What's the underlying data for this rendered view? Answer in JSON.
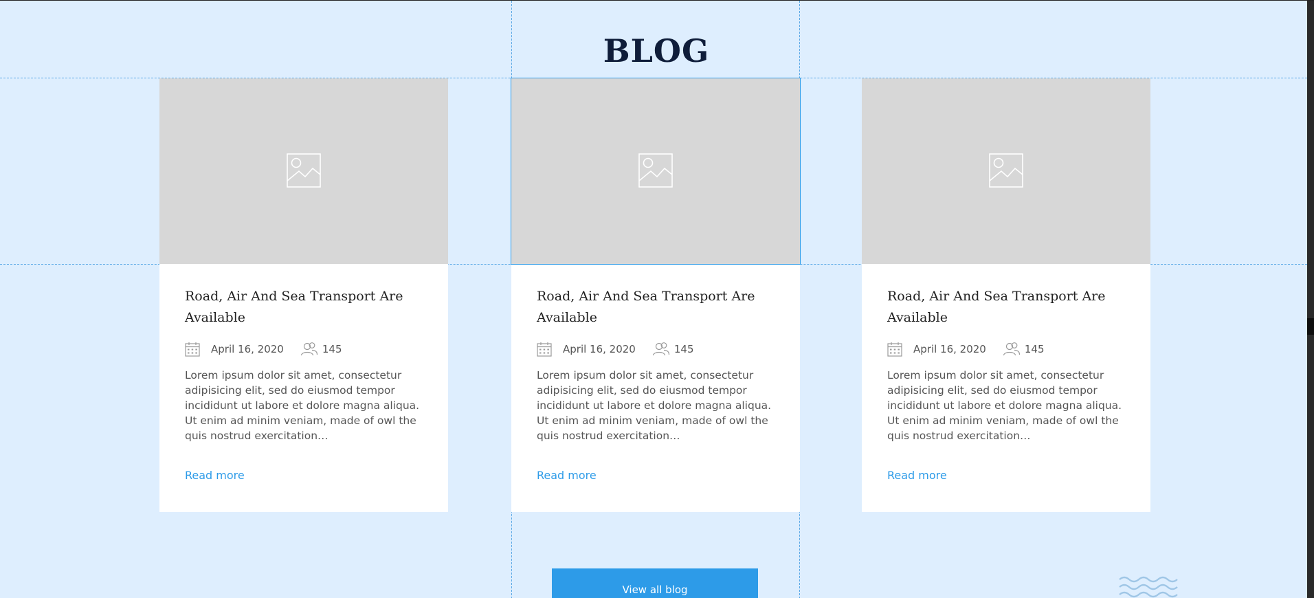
{
  "section": {
    "title": "BLOG"
  },
  "posts": [
    {
      "title": "Road, Air And Sea Transport Are Available",
      "date": "April 16, 2020",
      "views": "145",
      "excerpt": "Lorem ipsum dolor sit amet, consectetur adipisicing elit, sed do eiusmod tempor incididunt ut labore et dolore magna aliqua. Ut enim ad minim veniam, made of owl the quis nostrud exercitation…",
      "read_more": "Read more",
      "image_icon": "image-placeholder-icon"
    },
    {
      "title": "Road, Air And Sea Transport Are Available",
      "date": "April 16, 2020",
      "views": "145",
      "excerpt": "Lorem ipsum dolor sit amet, consectetur adipisicing elit, sed do eiusmod tempor incididunt ut labore et dolore magna aliqua. Ut enim ad minim veniam, made of owl the quis nostrud exercitation…",
      "read_more": "Read more",
      "image_icon": "image-placeholder-icon"
    },
    {
      "title": "Road, Air And Sea Transport Are Available",
      "date": "April 16, 2020",
      "views": "145",
      "excerpt": "Lorem ipsum dolor sit amet, consectetur adipisicing elit, sed do eiusmod tempor incididunt ut labore et dolore magna aliqua. Ut enim ad minim veniam, made of owl the quis nostrud exercitation…",
      "read_more": "Read more",
      "image_icon": "image-placeholder-icon"
    }
  ],
  "view_all_button": {
    "label": "View all blog"
  },
  "icons": {
    "date": "calendar-icon",
    "views": "users-icon",
    "decoration": "waves-icon"
  },
  "colors": {
    "background": "#deeefe",
    "accent": "#2d9be8",
    "title": "#0f1d3a",
    "image_placeholder": "#d7d7d7",
    "guides": "#5aa8e6"
  }
}
